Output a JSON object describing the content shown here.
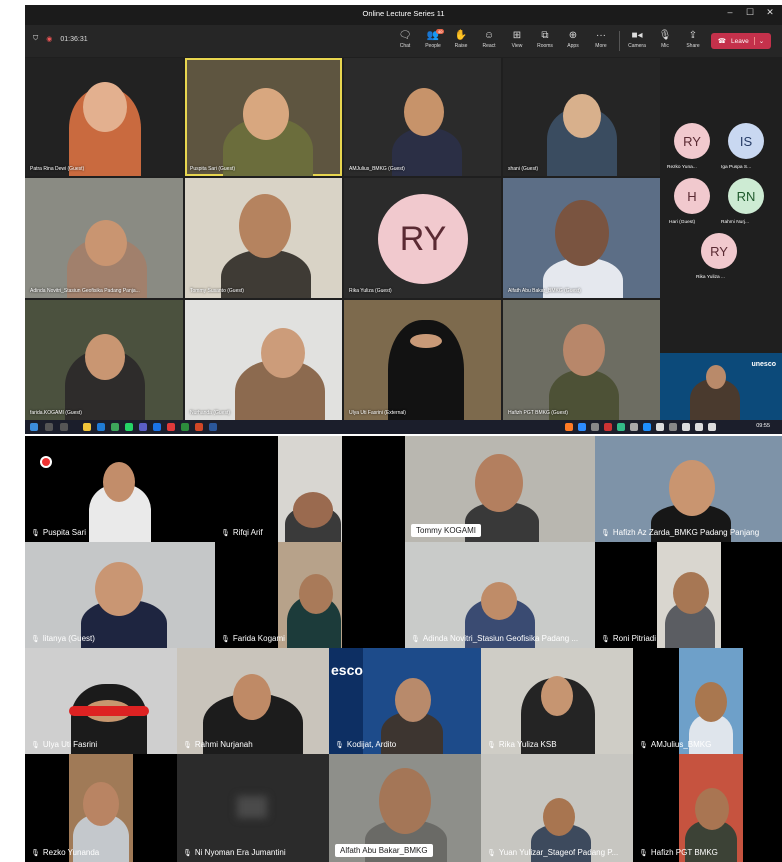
{
  "teams": {
    "window_title": "Online Lecture Series 11",
    "call_timer": "01:36:31",
    "toolbar": [
      {
        "label": "Chat",
        "icon": "chat-icon"
      },
      {
        "label": "People",
        "icon": "people-icon",
        "badge": "40"
      },
      {
        "label": "Raise",
        "icon": "raise-hand-icon"
      },
      {
        "label": "React",
        "icon": "react-icon"
      },
      {
        "label": "View",
        "icon": "view-icon"
      },
      {
        "label": "Rooms",
        "icon": "rooms-icon"
      },
      {
        "label": "Apps",
        "icon": "apps-icon"
      },
      {
        "label": "More",
        "icon": "more-icon"
      },
      {
        "label": "Camera",
        "icon": "camera-icon"
      },
      {
        "label": "Mic",
        "icon": "mic-icon"
      },
      {
        "label": "Share",
        "icon": "share-icon"
      }
    ],
    "leave_label": "Leave",
    "tiles": [
      {
        "name": "Patra Rina Dewi (Guest)"
      },
      {
        "name": "Puspita Sari (Guest)"
      },
      {
        "name": "AMJulius_BMKG (Guest)"
      },
      {
        "name": "shani (Guest)"
      },
      {
        "name": "Adinda Novitri_Stasiun Geofisika Padang Panja..."
      },
      {
        "name": "Tommy Susanto (Guest)"
      },
      {
        "name": "Rika Yuliza (Guest)",
        "initials": "RY"
      },
      {
        "name": "Alfath Abu Bakar_BMKG (Guest)"
      },
      {
        "name": "farida.KOGAMI (Guest)"
      },
      {
        "name": "Nurhanda (Guest)"
      },
      {
        "name": "Ulya Uti Fasrini (External)"
      },
      {
        "name": "Hafizh PGT BMKG (Guest)"
      }
    ],
    "rail": [
      {
        "initials": "RY",
        "name": "Rezko Yuna...",
        "color": "#f1c9ce"
      },
      {
        "initials": "IS",
        "name": "Iga Puspa S...",
        "color": "#c9d8f1"
      },
      {
        "initials": "H",
        "name": "Hari (Guest)",
        "color": "#f1c9ce"
      },
      {
        "initials": "RN",
        "name": "Rahmi Nurj...",
        "color": "#cdebd3"
      },
      {
        "initials": "RY",
        "name": "Rika Yuliza ...",
        "color": "#f1c9ce"
      }
    ],
    "screen_share_text": "unesco"
  },
  "taskbar": {
    "clock": "09:55"
  },
  "zoom": {
    "tiles": [
      {
        "name": "Puspita Sari"
      },
      {
        "name": "Rifqi Arif"
      },
      {
        "name": "Tommy KOGAMI"
      },
      {
        "name": "Hafizh Az Zarda_BMKG Padang Panjang"
      },
      {
        "name": "litanya (Guest)"
      },
      {
        "name": "Farida Kogami"
      },
      {
        "name": "Adinda Novitri_Stasiun Geofisika Padang ..."
      },
      {
        "name": "Roni Pitriadi"
      },
      {
        "name": "Ulya Uti Fasrini"
      },
      {
        "name": "Rahmi Nurjanah"
      },
      {
        "name": "Kodijat, Ardito"
      },
      {
        "name": "Rika Yuliza KSB"
      },
      {
        "name": "AMJulius_BMKG"
      },
      {
        "name": "Rezko Yunanda"
      },
      {
        "name": "Ni Nyoman Era Jumantini"
      },
      {
        "name": "Alfath Abu Bakar_BMKG"
      },
      {
        "name": "Yuan Yulizar_Stageof Padang P..."
      },
      {
        "name": "Hafizh PGT BMKG"
      }
    ],
    "screen_text": "esco"
  }
}
